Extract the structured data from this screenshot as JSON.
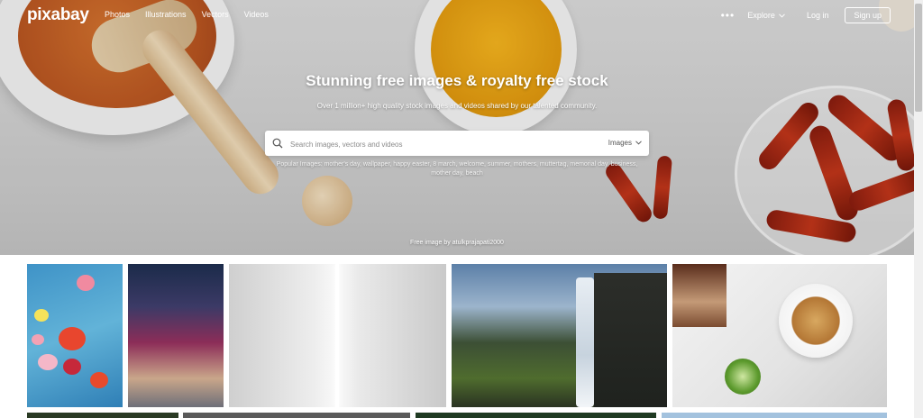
{
  "brand": {
    "logo": "pixabay"
  },
  "nav": {
    "links": [
      "Photos",
      "Illustrations",
      "Vectors",
      "Videos"
    ],
    "more": "•••",
    "explore": "Explore",
    "login": "Log in",
    "signup": "Sign up"
  },
  "hero": {
    "headline": "Stunning free images & royalty free stock",
    "subheadline": "Over 1 million+ high quality stock images and videos shared by our talented community.",
    "search": {
      "placeholder": "Search images, vectors and videos",
      "type": "Images"
    },
    "popular": "Popular Images: mother's day, wallpaper, happy easter, 8 march, welcome, summer, mothers, muttertag, memorial day, business, mother day, beach",
    "credit": "Free image by atulkprajapati2000"
  },
  "icons": {
    "search": "search-icon",
    "explore_chevron": "chevron-down-icon",
    "type_chevron": "chevron-down-icon",
    "more": "more-dots-icon"
  },
  "colors": {
    "white": "#ffffff",
    "text_dark": "#333333"
  }
}
